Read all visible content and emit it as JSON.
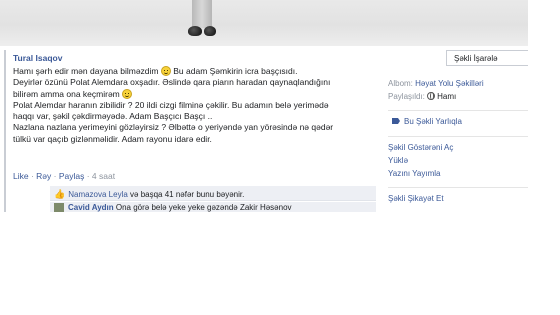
{
  "photo": {
    "tag_label": "Şəkli İşarələ"
  },
  "post": {
    "author": "Tural Isaqov",
    "lines": [
      "Hamı şərh edir mən dayana bilməzdim",
      " Bu adam Şəmkirin icra başçısıdı.",
      "Deyirlər özünü Polat Alemdara oxşadır. Əslində qara piarın haradan qaynaqlandığını",
      "bilirəm amma ona keçmirəm",
      "Polat Alemdar haranın zibilidir ? 20 ildi cizgi filminə çəkilir. Bu adamın belə yerimədə",
      "haqqı var, şəkil çəkdirməyədə. Adam Başçıcı Başçı ..",
      "Nazlana nazlana yerimeyini gözləyirsiz ? Əlbəttə o yeriyəndə yan yörəsində nə qədər",
      "tülkü var qaçıb gizlənməlidir. Adam rayonu idarə edir."
    ],
    "actions": {
      "like": "Like",
      "reply": "Rəy",
      "share": "Paylaş",
      "separator": " · ",
      "time": "4 saat"
    },
    "likes": {
      "prefix": "Namazova Leyla",
      "rest": " və başqa 41 nəfər ",
      "suffix": "bunu bəyənir."
    },
    "comment": {
      "name": "Cavid Aydın",
      "text": " Ona görə belə yeke yeke gəzəndə Zakir Həsənov"
    }
  },
  "sidebar": {
    "album_label": "Albom: ",
    "album_value": "Həyat Yolu Şəkilləri",
    "shared_label": "Paylaşıldı: ",
    "shared_value": "Hamı",
    "tag_label": "Bu Şəkli Yarlıqla",
    "links": [
      "Şəkil Göstərəni Aç",
      "Yüklə",
      "Yazını Yayımla"
    ],
    "report": "Şəkli Şikayət Et"
  }
}
